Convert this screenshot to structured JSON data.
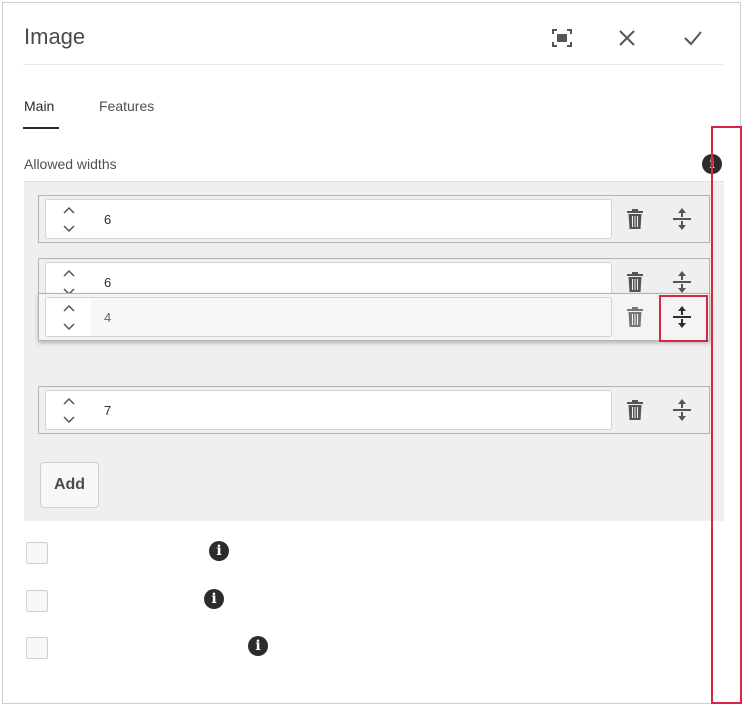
{
  "dialog": {
    "title": "Image",
    "actions": {
      "fullscreen_icon": "fullscreen-icon",
      "close_icon": "close-icon",
      "confirm_icon": "checkmark-icon"
    }
  },
  "tabs": [
    {
      "label": "Main",
      "active": true
    },
    {
      "label": "Features",
      "active": false
    }
  ],
  "allowed_widths": {
    "label": "Allowed widths",
    "rows": [
      {
        "value": "6"
      },
      {
        "value": "6"
      },
      {
        "value": "4",
        "state": "dragging"
      },
      {
        "value": "7"
      }
    ],
    "add_label": "Add"
  },
  "checkboxes": [
    {
      "checked": false
    },
    {
      "checked": false
    },
    {
      "checked": false
    }
  ],
  "colors": {
    "highlight": "#d7263d",
    "icon": "#555555",
    "text": "#2c2c2c"
  }
}
